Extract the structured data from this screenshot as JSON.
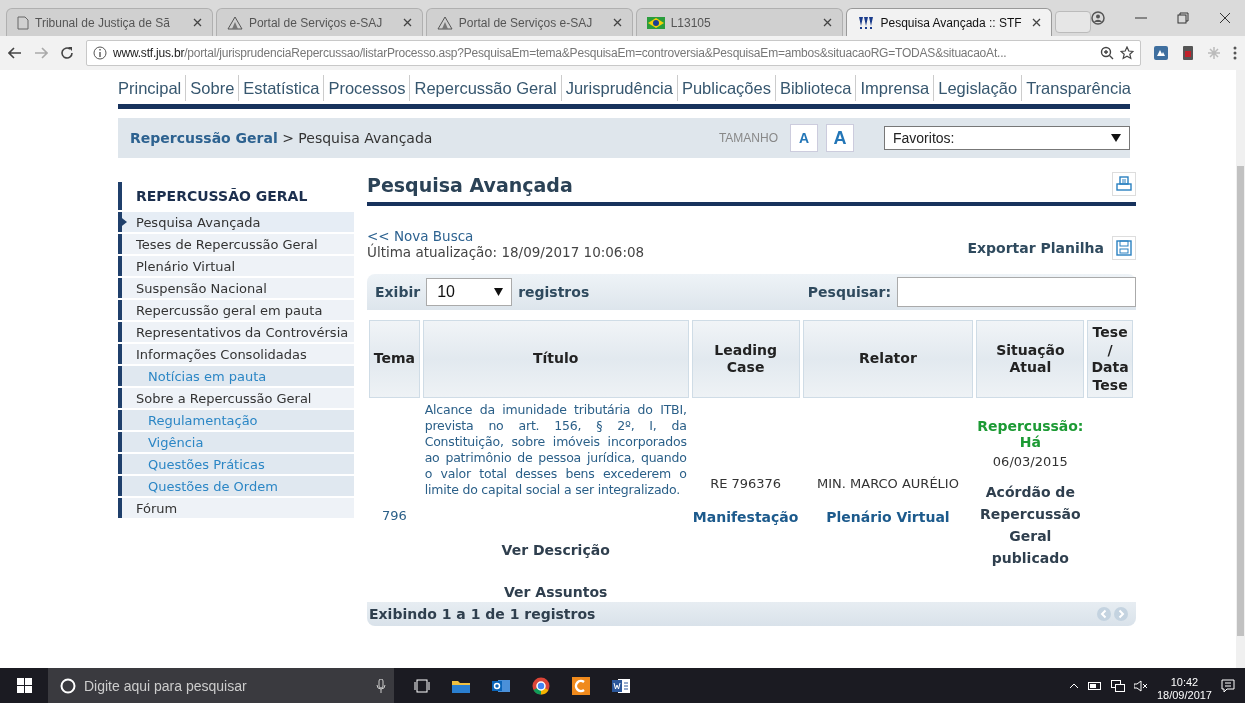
{
  "browser": {
    "tabs": [
      {
        "title": "Tribunal de Justiça de Sã",
        "selected": false
      },
      {
        "title": "Portal de Serviços e-SAJ",
        "selected": false
      },
      {
        "title": "Portal de Serviços e-SAJ",
        "selected": false
      },
      {
        "title": "L13105",
        "selected": false
      },
      {
        "title": "Pesquisa Avançada :: STF",
        "selected": true
      }
    ],
    "url_host": "www.stf.jus.br",
    "url_path": "/portal/jurisprudenciaRepercussao/listarProcesso.asp?PesquisaEm=tema&PesquisaEm=controversia&PesquisaEm=ambos&situacaoRG=TODAS&situacaoAt..."
  },
  "site": {
    "nav": [
      "Principal",
      "Sobre",
      "Estatística",
      "Processos",
      "Repercussão Geral",
      "Jurisprudência",
      "Publicações",
      "Biblioteca",
      "Imprensa",
      "Legislação",
      "Transparência"
    ],
    "breadcrumb": {
      "link": "Repercussão Geral",
      "current": " > Pesquisa Avançada"
    },
    "size_label": "TAMANHO",
    "size_buttons": [
      "A",
      "A"
    ],
    "favorites": "Favoritos:"
  },
  "sidebar": {
    "heading": "REPERCUSSÃO GERAL",
    "items": [
      {
        "label": "Pesquisa Avançada",
        "kind": "item",
        "selected": true
      },
      {
        "label": "Teses de Repercussão Geral",
        "kind": "item",
        "selected": false
      },
      {
        "label": "Plenário Virtual",
        "kind": "item",
        "selected": false
      },
      {
        "label": "Suspensão Nacional",
        "kind": "item",
        "selected": false
      },
      {
        "label": "Repercussão geral em pauta",
        "kind": "item",
        "selected": false
      },
      {
        "label": "Representativos da Controvérsia",
        "kind": "item",
        "selected": false
      },
      {
        "label": "Informações Consolidadas",
        "kind": "item",
        "selected": false
      },
      {
        "label": "Notícias em pauta",
        "kind": "subitem",
        "selected": false
      },
      {
        "label": "Sobre a Repercussão Geral",
        "kind": "item",
        "selected": false
      },
      {
        "label": "Regulamentação",
        "kind": "subitem",
        "selected": false
      },
      {
        "label": "Vigência",
        "kind": "subitem",
        "selected": false
      },
      {
        "label": "Questões Práticas",
        "kind": "subitem",
        "selected": false
      },
      {
        "label": "Questões de Ordem",
        "kind": "subitem",
        "selected": false
      },
      {
        "label": "Fórum",
        "kind": "item",
        "selected": false
      }
    ]
  },
  "main": {
    "title": "Pesquisa Avançada",
    "new_search": "<< Nova Busca",
    "last_update": "Última atualização: 18/09/2017 10:06:08",
    "export": "Exportar Planilha",
    "show_label": "Exibir",
    "page_size": "10",
    "records_label": "registros",
    "search_label": "Pesquisar:",
    "columns": [
      "Tema",
      "Título",
      "Leading Case",
      "Relator",
      "Situação Atual",
      "Tese / Data Tese"
    ],
    "rows": [
      {
        "tema": "796",
        "titulo": "Alcance da imunidade tributária do ITBI, prevista no art. 156, § 2º, I, da Constituição, sobre imóveis incorporados ao patrimônio de pessoa jurídica, quando o valor total desses bens excederem o limite do capital social a ser integralizado.",
        "links": [
          "Ver Descrição",
          "Ver Assuntos"
        ],
        "leading_case": "RE 796376",
        "leading_link": "Manifestação",
        "relator": "MIN. MARCO AURÉLIO",
        "relator_link": "Plenário Virtual",
        "status": "Repercussão: Há",
        "status_date": "06/03/2015",
        "status_note": "Acórdão de Repercussão Geral publicado"
      }
    ],
    "footer": "Exibindo 1 a 1 de 1 registros"
  },
  "taskbar": {
    "search_placeholder": "Digite aqui para pesquisar",
    "time": "10:42",
    "date": "18/09/2017"
  }
}
